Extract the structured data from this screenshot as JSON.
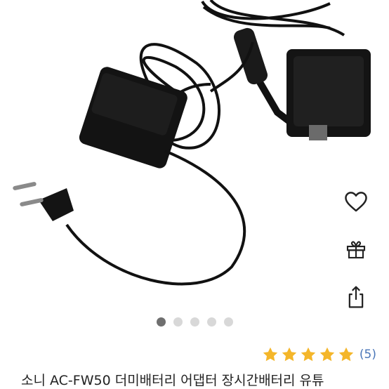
{
  "product": {
    "title": "소니 AC-FW50 더미배터리 어댑터 장시간배터리 유튜",
    "rating_count": "(5)",
    "rating_stars": 5,
    "rating_max": 5
  },
  "carousel": {
    "total": 5,
    "active_index": 0
  },
  "actions": {
    "favorite_icon": "heart-outline-icon",
    "gift_icon": "gift-icon",
    "share_icon": "share-upload-icon"
  },
  "colors": {
    "star": "#f4b62a",
    "rating_text": "#4a76b8",
    "active_dot": "#6f6f6f",
    "inactive_dot": "#d8d8d8"
  }
}
